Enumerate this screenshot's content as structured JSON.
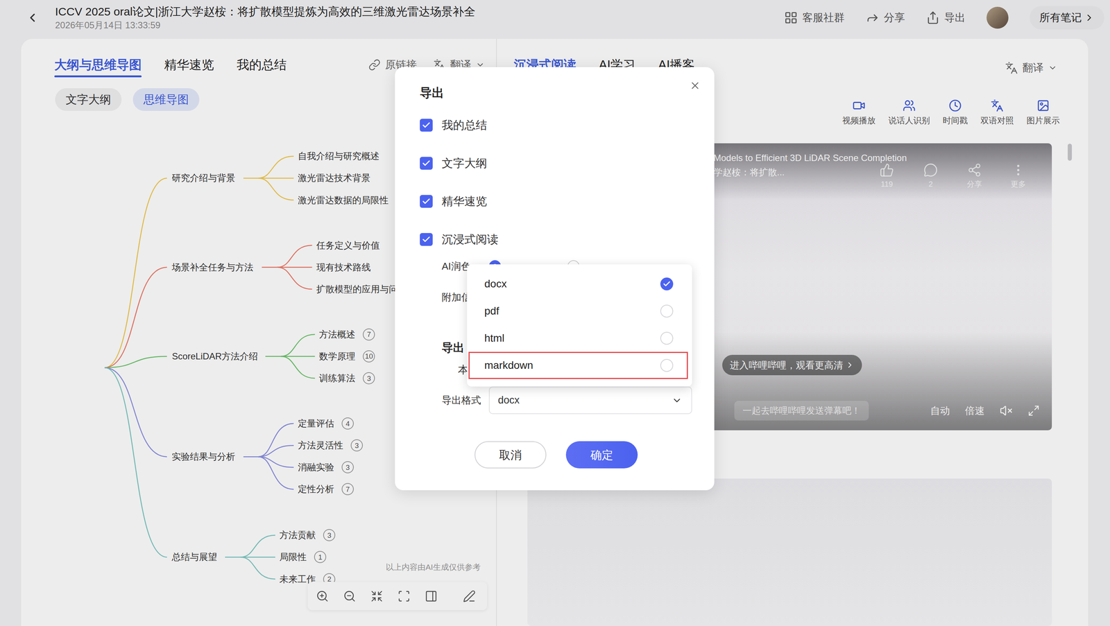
{
  "header": {
    "title": "ICCV 2025 oral论文|浙江大学赵桉：将扩散模型提炼为高效的三维激光雷达场景补全",
    "date": "2026年05月14日 13:33:59",
    "actions": [
      {
        "label": "客服社群"
      },
      {
        "label": "分享"
      },
      {
        "label": "导出"
      }
    ],
    "notes_button": "所有笔记"
  },
  "left_panel": {
    "tabs": [
      {
        "label": "大纲与思维导图",
        "selected": true
      },
      {
        "label": "精华速览",
        "selected": false
      },
      {
        "label": "我的总结",
        "selected": false
      }
    ],
    "links": [
      {
        "label": "原链接"
      },
      {
        "label": "翻译"
      }
    ],
    "view_tabs": [
      {
        "label": "文字大纲",
        "selected": false
      },
      {
        "label": "思维导图",
        "selected": true
      }
    ],
    "mindmap": {
      "branches": [
        {
          "label": "研究介绍与背景",
          "color": "#f2c94c",
          "children": [
            {
              "label": "自我介绍与研究概述",
              "count": null
            },
            {
              "label": "激光雷达技术背景",
              "count": null
            },
            {
              "label": "激光雷达数据的局限性",
              "count": null
            }
          ]
        },
        {
          "label": "场景补全任务与方法",
          "color": "#ee7a6a",
          "children": [
            {
              "label": "任务定义与价值",
              "count": null
            },
            {
              "label": "现有技术路线",
              "count": null
            },
            {
              "label": "扩散模型的应用与问",
              "count": null
            }
          ]
        },
        {
          "label": "ScoreLiDAR方法介绍",
          "color": "#6cc46c",
          "children": [
            {
              "label": "方法概述",
              "count": "7"
            },
            {
              "label": "数学原理",
              "count": "10"
            },
            {
              "label": "训练算法",
              "count": "3"
            }
          ]
        },
        {
          "label": "实验结果与分析",
          "color": "#8a8fe0",
          "children": [
            {
              "label": "定量评估",
              "count": "4"
            },
            {
              "label": "方法灵活性",
              "count": "3"
            },
            {
              "label": "消融实验",
              "count": "3"
            },
            {
              "label": "定性分析",
              "count": "7"
            }
          ]
        },
        {
          "label": "总结与展望",
          "color": "#7cc7c2",
          "children": [
            {
              "label": "方法贡献",
              "count": "3"
            },
            {
              "label": "局限性",
              "count": "1"
            },
            {
              "label": "未来工作",
              "count": "2"
            }
          ]
        }
      ]
    },
    "disclaimer": "以上内容由AI生成仅供参考"
  },
  "right_panel": {
    "tabs": [
      {
        "label": "沉浸式阅读",
        "selected": true
      },
      {
        "label": "AI学习",
        "selected": false
      },
      {
        "label": "AI播客",
        "selected": false
      }
    ],
    "translate": "翻译",
    "tools": [
      {
        "label": "视频播放"
      },
      {
        "label": "说话人识别"
      },
      {
        "label": "时间戳"
      },
      {
        "label": "双语对照"
      },
      {
        "label": "图片展示"
      }
    ],
    "player": {
      "title_lines": [
        "Models to Efficient 3D LiDAR Scene Completion",
        "学赵桉：将扩散..."
      ],
      "stats": [
        "119",
        "2",
        "分享",
        "更多"
      ],
      "hd_prompt": "进入哔哩哔哩，观看更高清",
      "danmaku_placeholder": "一起去哔哩哔哩发送弹幕吧！",
      "controls": [
        "自动",
        "倍速"
      ]
    }
  },
  "dialog": {
    "title": "导出",
    "sections": [
      {
        "label": "我的总结",
        "checked": true
      },
      {
        "label": "文字大纲",
        "checked": true
      },
      {
        "label": "精华速览",
        "checked": true
      },
      {
        "label": "沉浸式阅读",
        "checked": true
      }
    ],
    "polish": {
      "label": "AI润色",
      "options": [
        {
          "selected": true
        },
        {
          "selected": false
        }
      ]
    },
    "extra_label": "附加信",
    "export_to": {
      "heading": "导出",
      "option": "本"
    },
    "format": {
      "label": "导出格式",
      "value": "docx",
      "open": true,
      "options": [
        {
          "label": "docx",
          "selected": true,
          "highlighted": false
        },
        {
          "label": "pdf",
          "selected": false,
          "highlighted": false
        },
        {
          "label": "html",
          "selected": false,
          "highlighted": false
        },
        {
          "label": "markdown",
          "selected": false,
          "highlighted": true
        }
      ]
    },
    "buttons": [
      {
        "label": "取消",
        "primary": false
      },
      {
        "label": "确定",
        "primary": true
      }
    ]
  }
}
